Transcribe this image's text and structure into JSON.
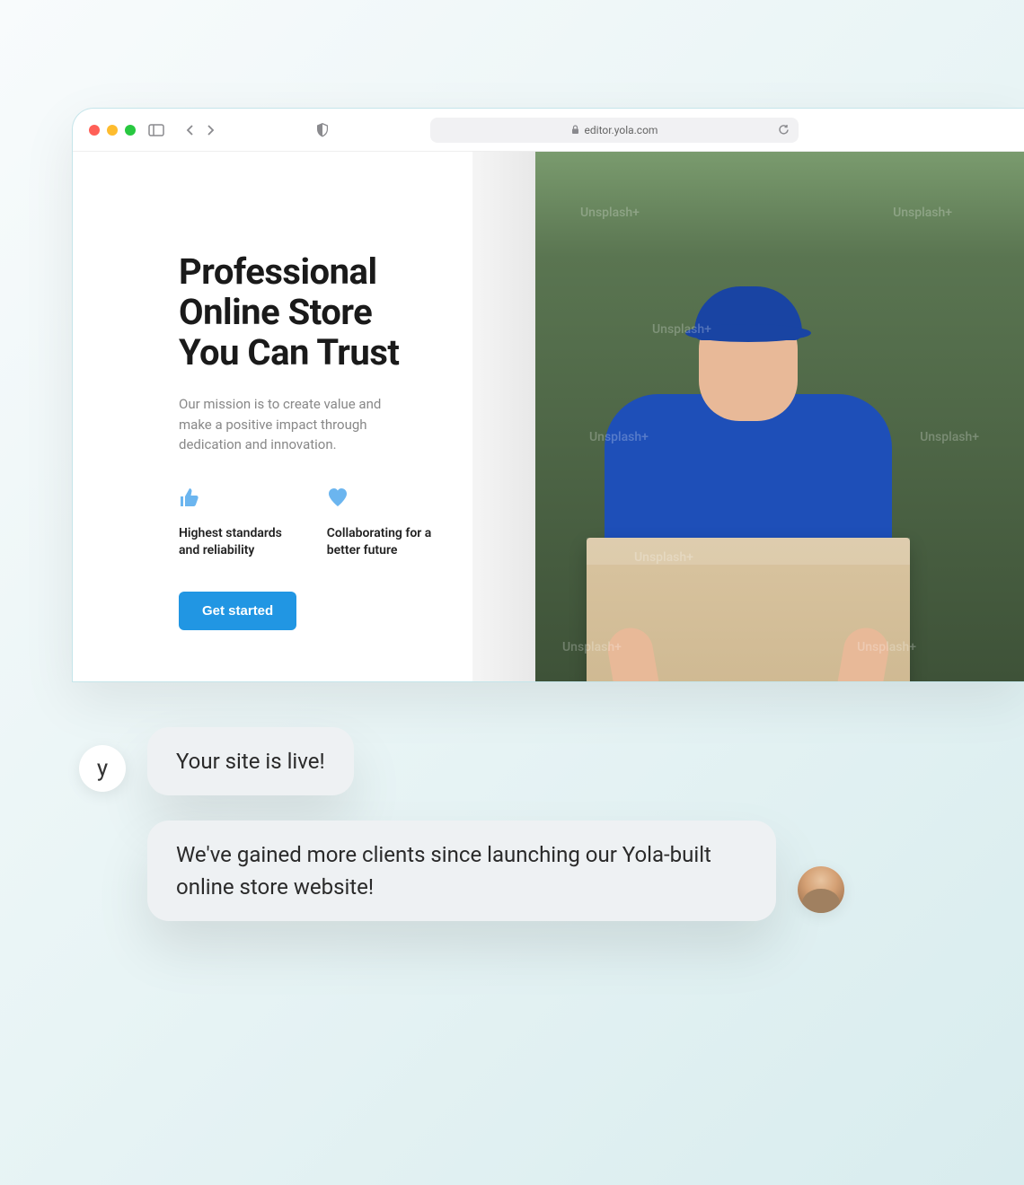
{
  "browser": {
    "url": "editor.yola.com"
  },
  "page": {
    "heading": "Professional Online Store You Can Trust",
    "mission": "Our mission is to create value and make a positive impact through dedication and innovation.",
    "features": [
      {
        "icon": "thumbs-up",
        "text": "Highest standards and reliability"
      },
      {
        "icon": "heart",
        "text": "Collaborating for a better future"
      }
    ],
    "cta": "Get started",
    "image_watermark": "Unsplash+"
  },
  "chat": {
    "bot_avatar_letter": "y",
    "messages": [
      "Your site is live!",
      "We've gained more clients since launching our Yola-built online store website!"
    ]
  }
}
